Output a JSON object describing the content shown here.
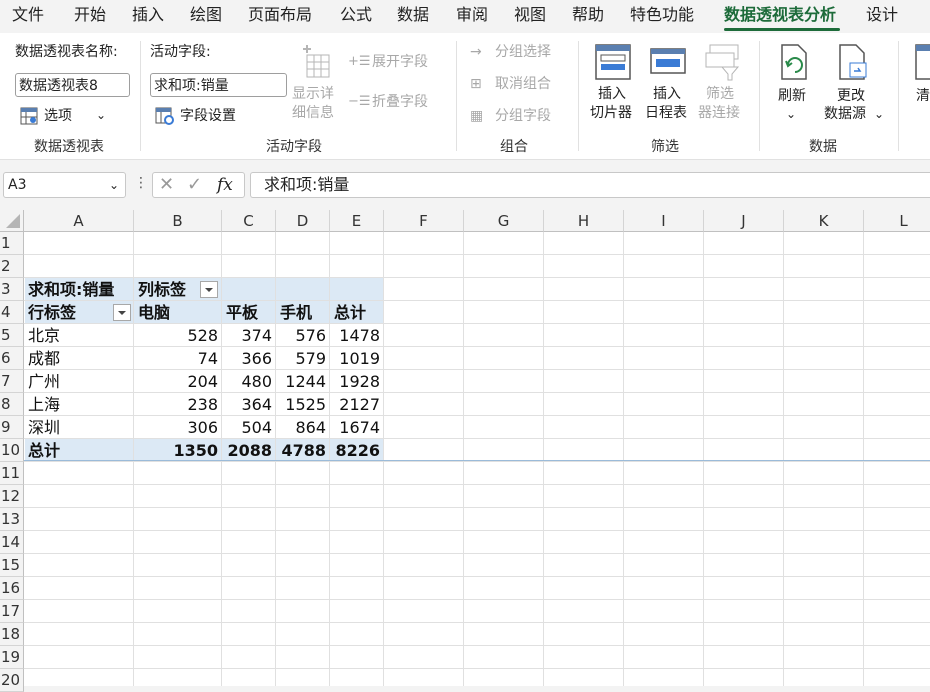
{
  "menu": {
    "items": [
      "文件",
      "开始",
      "插入",
      "绘图",
      "页面布局",
      "公式",
      "数据",
      "审阅",
      "视图",
      "帮助",
      "特色功能",
      "数据透视表分析",
      "设计"
    ],
    "active": "数据透视表分析",
    "accent": "#1d6b3a"
  },
  "ribbon": {
    "pivot_group": {
      "name_label": "数据透视表名称:",
      "name_value": "数据透视表8",
      "options_label": "选项",
      "group_label": "数据透视表"
    },
    "active_field_group": {
      "label": "活动字段:",
      "value": "求和项:销量",
      "settings_label": "字段设置",
      "show_detail_line1": "显示详",
      "show_detail_line2": "细信息",
      "expand_label": "展开字段",
      "collapse_label": "折叠字段",
      "group_label": "活动字段"
    },
    "group_group": {
      "group_selection": "分组选择",
      "ungroup": "取消组合",
      "group_field": "分组字段",
      "group_label": "组合"
    },
    "filter_group": {
      "slicer_line1": "插入",
      "slicer_line2": "切片器",
      "timeline_line1": "插入",
      "timeline_line2": "日程表",
      "conn_line1": "筛选",
      "conn_line2": "器连接",
      "group_label": "筛选"
    },
    "data_group": {
      "refresh_label": "刷新",
      "change_line1": "更改",
      "change_line2": "数据源",
      "group_label": "数据"
    },
    "clear_label": "清"
  },
  "formula_bar": {
    "name_box": "A3",
    "fx": "fx",
    "formula": "求和项:销量"
  },
  "sheet": {
    "columns": [
      "A",
      "B",
      "C",
      "D",
      "E",
      "F",
      "G",
      "H",
      "I",
      "J",
      "K",
      "L"
    ],
    "rows": [
      "1",
      "2",
      "3",
      "4",
      "5",
      "6",
      "7",
      "8",
      "9",
      "10",
      "11",
      "12",
      "13",
      "14",
      "15",
      "16",
      "17",
      "18",
      "19",
      "20"
    ],
    "pivot": {
      "value_header": "求和项:销量",
      "col_labels_header": "列标签",
      "row_labels_header": "行标签",
      "col_headers": [
        "电脑",
        "平板",
        "手机",
        "总计"
      ],
      "rows": [
        {
          "label": "北京",
          "values": [
            "528",
            "374",
            "576",
            "1478"
          ]
        },
        {
          "label": "成都",
          "values": [
            "74",
            "366",
            "579",
            "1019"
          ]
        },
        {
          "label": "广州",
          "values": [
            "204",
            "480",
            "1244",
            "1928"
          ]
        },
        {
          "label": "上海",
          "values": [
            "238",
            "364",
            "1525",
            "2127"
          ]
        },
        {
          "label": "深圳",
          "values": [
            "306",
            "504",
            "864",
            "1674"
          ]
        }
      ],
      "total_label": "总计",
      "totals": [
        "1350",
        "2088",
        "4788",
        "8226"
      ],
      "header_fill": "#dce9f5"
    }
  }
}
